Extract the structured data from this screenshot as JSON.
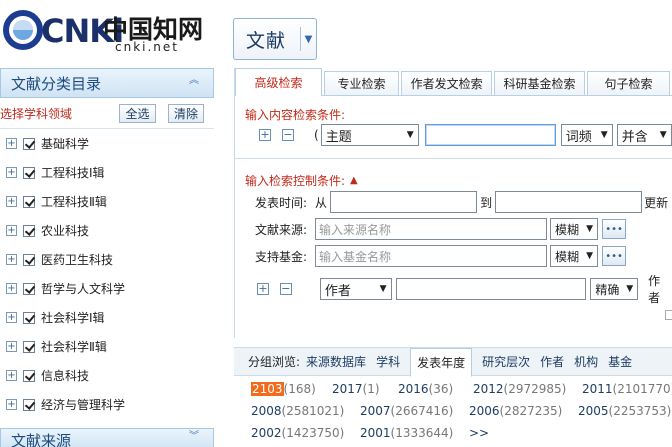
{
  "header": {
    "logo_text": "CNKi",
    "logo_cn": "中国知网",
    "logo_url": "cnki.net",
    "doc_type": "文献"
  },
  "sidebar": {
    "title": "文献分类目录",
    "select_label": "选择学科领域",
    "select_all": "全选",
    "clear": "清除",
    "categories": [
      {
        "label": "基础科学"
      },
      {
        "label": "工程科技Ⅰ辑"
      },
      {
        "label": "工程科技Ⅱ辑"
      },
      {
        "label": "农业科技"
      },
      {
        "label": "医药卫生科技"
      },
      {
        "label": "哲学与人文科学"
      },
      {
        "label": "社会科学Ⅰ辑"
      },
      {
        "label": "社会科学Ⅱ辑"
      },
      {
        "label": "信息科技"
      },
      {
        "label": "经济与管理科学"
      }
    ],
    "footer_title": "文献来源"
  },
  "tabs": [
    "高级检索",
    "专业检索",
    "作者发文检索",
    "科研基金检索",
    "句子检索"
  ],
  "content_search": {
    "title": "输入内容检索条件:",
    "paren": "(",
    "field": "主题",
    "value": "",
    "match": "词频",
    "combine": "并含"
  },
  "control": {
    "title": "输入检索控制条件:",
    "time_label": "发表时间:",
    "from_label": "从",
    "to_label": "到",
    "update_label": "更新",
    "source_label": "文献来源:",
    "source_placeholder": "输入来源名称",
    "source_match": "模糊",
    "fund_label": "支持基金:",
    "fund_placeholder": "输入基金名称",
    "fund_match": "模糊",
    "author_field": "作者",
    "author_match": "精确",
    "author_tail": "作者"
  },
  "group_browse": {
    "label": "分组浏览:",
    "items": [
      "来源数据库",
      "学科",
      "发表年度",
      "研究层次",
      "作者",
      "机构",
      "基金"
    ],
    "active": "发表年度",
    "years": [
      {
        "year": "2103",
        "count": "(168)"
      },
      {
        "year": "2017",
        "count": "(1)"
      },
      {
        "year": "2016",
        "count": "(36)"
      },
      {
        "year": "2012",
        "count": "(2972985)"
      },
      {
        "year": "2011",
        "count": "(2101770)"
      },
      {
        "year": "2008",
        "count": "(2581021)"
      },
      {
        "year": "2007",
        "count": "(2667416)"
      },
      {
        "year": "2006",
        "count": "(2827235)"
      },
      {
        "year": "2005",
        "count": "(2253753)"
      },
      {
        "year": "2002",
        "count": "(1423750)"
      },
      {
        "year": "2001",
        "count": "(1333644)"
      }
    ],
    "more": ">>"
  }
}
